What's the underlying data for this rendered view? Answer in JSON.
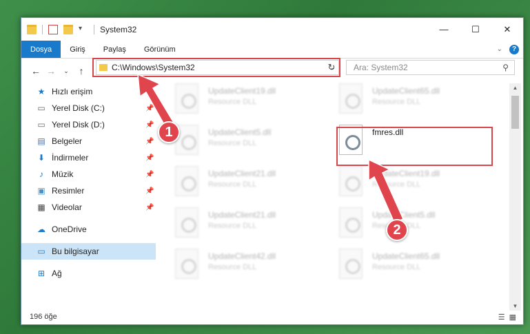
{
  "window": {
    "title": "System32",
    "buttons": {
      "minimize": "—",
      "maximize": "☐",
      "close": "✕"
    }
  },
  "ribbon": {
    "tabs": [
      "Dosya",
      "Giriş",
      "Paylaş",
      "Görünüm"
    ],
    "help": "?"
  },
  "address": {
    "path": "C:\\Windows\\System32",
    "search_placeholder": "Ara: System32"
  },
  "sidebar": {
    "items": [
      {
        "label": "Hızlı erişim",
        "icon": "star-icon"
      },
      {
        "label": "Yerel Disk (C:)",
        "icon": "drive-icon",
        "pinned": true
      },
      {
        "label": "Yerel Disk (D:)",
        "icon": "drive-icon",
        "pinned": true
      },
      {
        "label": "Belgeler",
        "icon": "documents-icon",
        "pinned": true
      },
      {
        "label": "İndirmeler",
        "icon": "download-icon",
        "pinned": true
      },
      {
        "label": "Müzik",
        "icon": "music-icon",
        "pinned": true
      },
      {
        "label": "Resimler",
        "icon": "pictures-icon",
        "pinned": true
      },
      {
        "label": "Videolar",
        "icon": "videos-icon",
        "pinned": true
      },
      {
        "label": "OneDrive",
        "icon": "cloud-icon"
      },
      {
        "label": "Bu bilgisayar",
        "icon": "computer-icon",
        "selected": true
      },
      {
        "label": "Ağ",
        "icon": "network-icon"
      }
    ]
  },
  "files": [
    {
      "name": "UpdateClient19.dll",
      "type": "Resource DLL"
    },
    {
      "name": "UpdateClient65.dll",
      "type": "Resource DLL"
    },
    {
      "name": "UpdateClient5.dll",
      "type": "Resource DLL"
    },
    {
      "name": "fmres.dll",
      "type": ""
    },
    {
      "name": "UpdateClient21.dll",
      "type": "Resource DLL"
    },
    {
      "name": "UpdateClient19.dll",
      "type": "Resource DLL"
    },
    {
      "name": "UpdateClient21.dll",
      "type": "Resource DLL"
    },
    {
      "name": "UpdateClient5.dll",
      "type": "Resource DLL"
    },
    {
      "name": "UpdateClient42.dll",
      "type": "Resource DLL"
    },
    {
      "name": "UpdateClient65.dll",
      "type": "Resource DLL"
    }
  ],
  "status": {
    "count": "196 öğe"
  },
  "annotations": {
    "badge1": "1",
    "badge2": "2"
  },
  "colors": {
    "accent": "#1979ca",
    "highlight": "#d9434a",
    "desktop": "#3f8f4a"
  }
}
